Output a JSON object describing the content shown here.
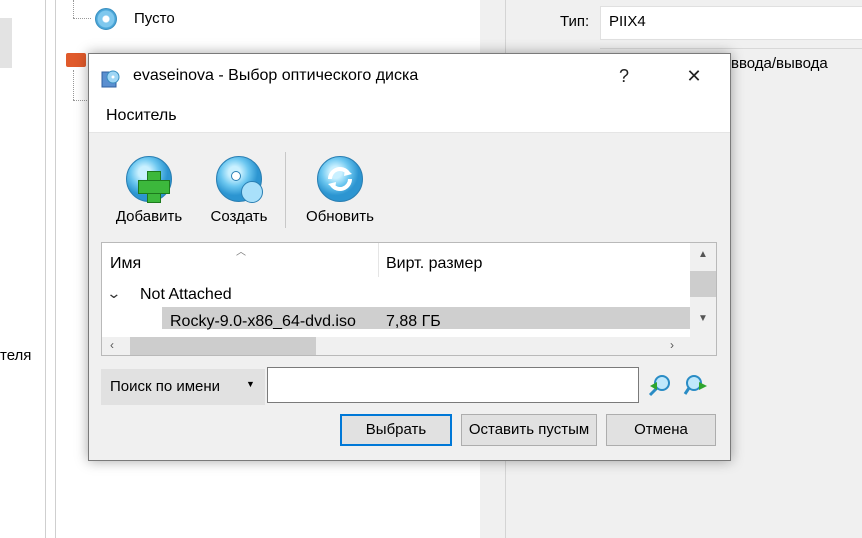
{
  "background": {
    "tree_item_label": "Пусто",
    "partial_left_label": "теля",
    "type_label": "Тип:",
    "type_value": "PIIX4",
    "io_label": "ввода/вывода"
  },
  "dialog": {
    "title": "evaseinova - Выбор оптического диска",
    "help": "?",
    "close": "✕",
    "menu": [
      "Носитель"
    ],
    "toolbar": {
      "add": "Добавить",
      "create": "Создать",
      "refresh": "Обновить"
    },
    "list": {
      "col_name": "Имя",
      "col_size": "Вирт. размер",
      "group_label": "Not Attached",
      "rows": [
        {
          "name": "Rocky-9.0-x86_64-dvd.iso",
          "size": "7,88 ГБ"
        }
      ]
    },
    "search": {
      "mode": "Поиск по имени",
      "value": ""
    },
    "buttons": {
      "choose": "Выбрать",
      "leave_empty": "Оставить пустым",
      "cancel": "Отмена"
    }
  }
}
